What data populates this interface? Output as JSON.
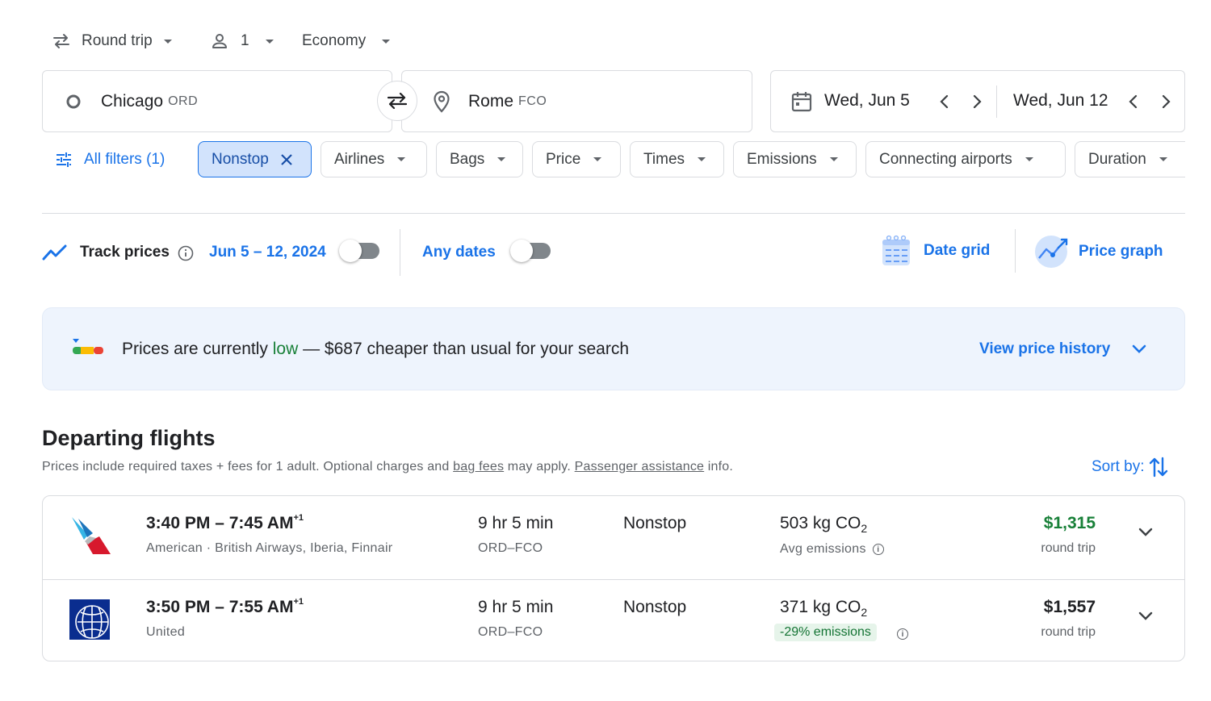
{
  "search": {
    "trip_type": "Round trip",
    "passengers": "1",
    "cabin": "Economy",
    "origin_city": "Chicago",
    "origin_code": "ORD",
    "destination_city": "Rome",
    "destination_code": "FCO",
    "depart_date": "Wed, Jun 5",
    "return_date": "Wed, Jun 12"
  },
  "filters": {
    "all_filters": "All filters (1)",
    "chips": [
      "Nonstop",
      "Airlines",
      "Bags",
      "Price",
      "Times",
      "Emissions",
      "Connecting airports",
      "Duration"
    ]
  },
  "tracking": {
    "track_label": "Track prices",
    "date_range": "Jun 5 – 12, 2024",
    "any_dates": "Any dates",
    "date_grid": "Date grid",
    "price_graph": "Price graph"
  },
  "insight": {
    "prefix": "Prices are currently ",
    "level": "low",
    "suffix": " — $687 cheaper than usual for your search",
    "link": "View price history"
  },
  "results": {
    "heading": "Departing flights",
    "note_1": "Prices include required taxes + fees for 1 adult. Optional charges and ",
    "note_bag_link": "bag fees",
    "note_2": " may apply. ",
    "note_pa_link": "Passenger assistance",
    "note_3": " info.",
    "sort_label": "Sort by:",
    "flights": [
      {
        "times": "3:40 PM – 7:45 AM",
        "day_offset": "+1",
        "airlines": "American · British Airways, Iberia, Finnair",
        "duration": "9 hr 5 min",
        "route": "ORD–FCO",
        "stops": "Nonstop",
        "emissions": "503 kg CO",
        "emissions_sub": "2",
        "emissions_note": "Avg emissions",
        "price": "$1,315",
        "price_type": "round trip"
      },
      {
        "times": "3:50 PM – 7:55 AM",
        "day_offset": "+1",
        "airlines": "United",
        "duration": "9 hr 5 min",
        "route": "ORD–FCO",
        "stops": "Nonstop",
        "emissions": "371 kg CO",
        "emissions_sub": "2",
        "emissions_note": "-29% emissions",
        "price": "$1,557",
        "price_type": "round trip"
      }
    ]
  },
  "colors": {
    "accent": "#1a73e8",
    "good_price": "#188038",
    "low_emissions_bg": "#e6f4ea"
  }
}
